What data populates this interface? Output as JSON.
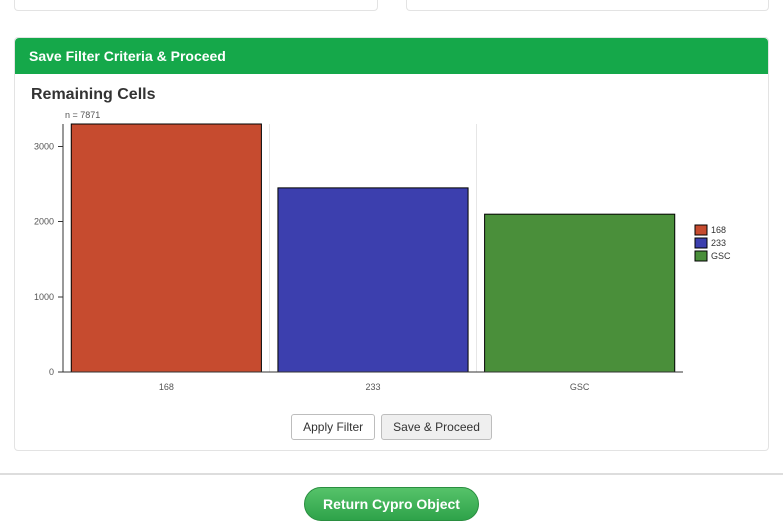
{
  "panel": {
    "header": "Save Filter Criteria & Proceed",
    "chart_title": "Remaining Cells",
    "subtitle": "n = 7871",
    "apply_label": "Apply Filter",
    "save_label": "Save & Proceed"
  },
  "footer": {
    "return_label": "Return Cypro Object"
  },
  "chart_data": {
    "type": "bar",
    "categories": [
      "168",
      "233",
      "GSC"
    ],
    "values": [
      3300,
      2450,
      2100
    ],
    "colors": [
      "#c64b2f",
      "#3c3fae",
      "#4a8f3a"
    ],
    "legend": [
      "168",
      "233",
      "GSC"
    ],
    "ylim": [
      0,
      3300
    ],
    "yticks": [
      0,
      1000,
      2000,
      3000
    ]
  }
}
